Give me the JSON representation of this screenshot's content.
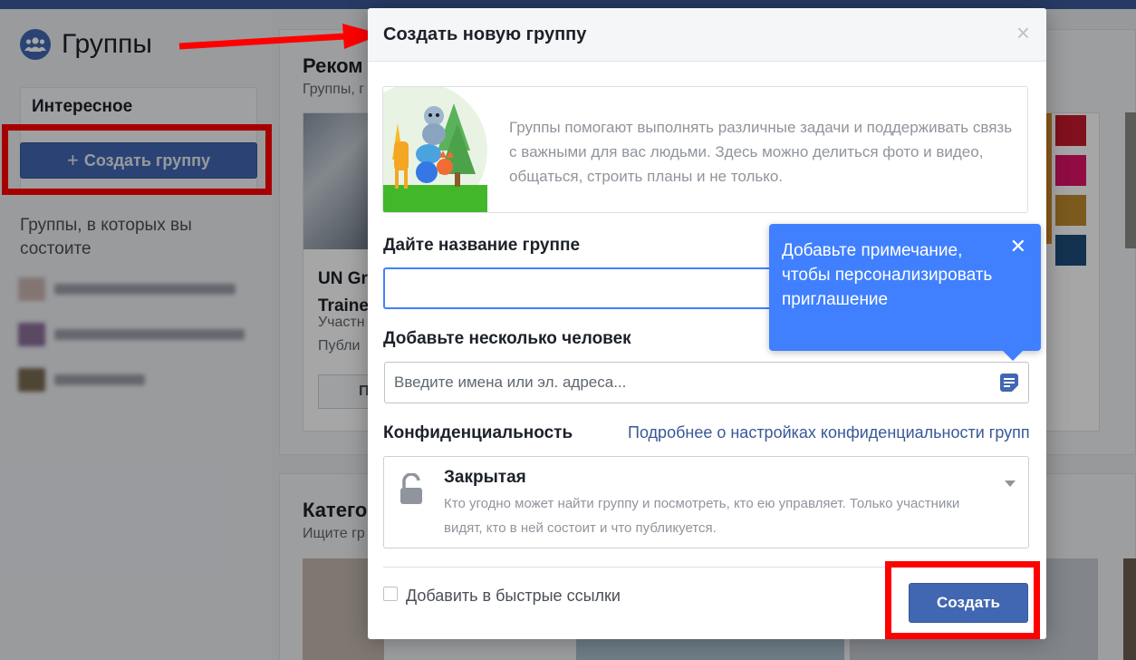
{
  "sidebar": {
    "title": "Группы",
    "section_title": "Интересное",
    "create_button_label": "Создать группу",
    "member_label": "Группы, в которых вы состоите"
  },
  "background": {
    "recommended_heading": "Реком",
    "recommended_sub": "Группы, г",
    "card": {
      "title_line1": "UN Gr",
      "title_line2": "Traine",
      "meta_line1": "Участн",
      "meta_line2": "Публи",
      "button_label": "П"
    },
    "categories_heading": "Катего",
    "categories_sub": "Ищите гр"
  },
  "modal": {
    "title": "Создать новую группу",
    "info_text": "Группы помогают выполнять различные задачи и поддерживать связь с важными для вас людьми. Здесь можно делиться фото и видео, общаться, строить планы и не только.",
    "name_label": "Дайте название группе",
    "name_value": "",
    "people_label": "Добавьте несколько человек",
    "people_placeholder": "Введите имена или эл. адреса...",
    "privacy_label": "Конфиденциальность",
    "privacy_link": "Подробнее о настройках конфиденциальности групп",
    "privacy_option_title": "Закрытая",
    "privacy_option_desc": "Кто угодно может найти группу и посмотреть, кто ею управляет. Только участники видят, кто в ней состоит и что публикуется.",
    "bookmark_label": "Добавить в быстрые ссылки",
    "submit_label": "Создать"
  },
  "tooltip": {
    "text": "Добавьте примечание, чтобы персонализировать приглашение",
    "close_glyph": "✕"
  },
  "icons": {
    "close": "close-icon",
    "plus": "plus-icon",
    "lock": "lock-icon",
    "note": "note-icon",
    "caret": "chevron-down-icon"
  },
  "colors": {
    "brand": "#4267b2",
    "tooltip": "#4080ff",
    "highlight": "#ff0000",
    "link": "#385898"
  }
}
